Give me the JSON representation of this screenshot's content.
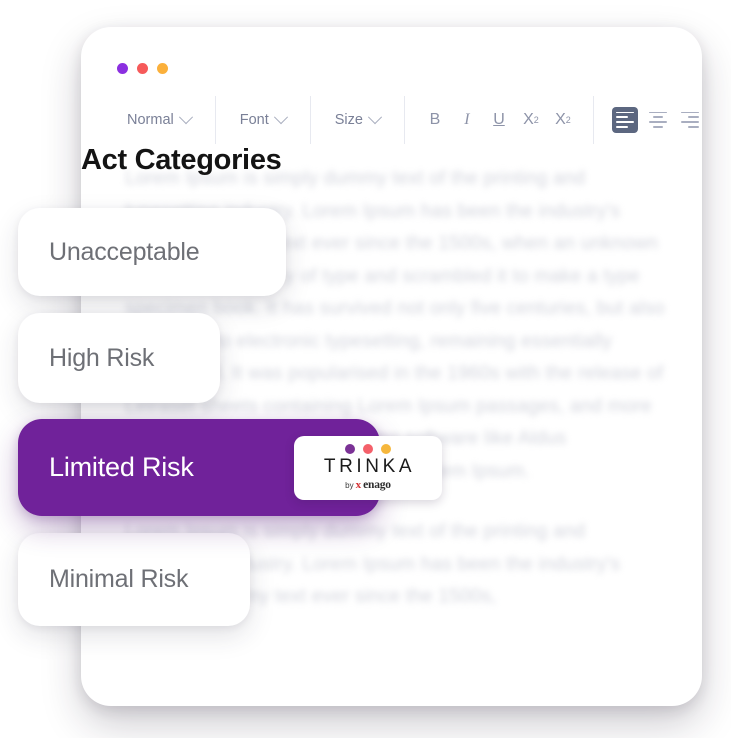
{
  "window": {
    "dots": [
      {
        "name": "purple",
        "color": "#8B2FE0"
      },
      {
        "name": "red",
        "color": "#F65A5A"
      },
      {
        "name": "amber",
        "color": "#FBB03B"
      }
    ]
  },
  "toolbar": {
    "style_select": "Normal",
    "font_select": "Font",
    "size_select": "Size",
    "format_buttons": [
      {
        "icon": "bold-icon",
        "label": "B"
      },
      {
        "icon": "italic-icon",
        "label": "I"
      },
      {
        "icon": "underline-icon",
        "label": "U"
      },
      {
        "icon": "subscript-icon",
        "label": "X",
        "script": "2"
      },
      {
        "icon": "superscript-icon",
        "label": "X",
        "script": "2"
      }
    ],
    "align_buttons": [
      {
        "icon": "align-left-icon",
        "active": true
      },
      {
        "icon": "align-center-icon",
        "active": false
      },
      {
        "icon": "align-right-icon",
        "active": false
      },
      {
        "icon": "align-justify-icon",
        "active": false
      }
    ],
    "list_buttons": [
      {
        "icon": "bulleted-list-icon"
      },
      {
        "icon": "checklist-icon"
      }
    ]
  },
  "page_title": "Act Categories",
  "document": {
    "paragraphs": [
      "Lorem Ipsum is simply dummy text of the printing and typesetting industry. Lorem Ipsum has been the industry's standard dummy text ever since the 1500s, when an unknown printer took a galley of type and scrambled it to make a type specimen book. It has survived not only five centuries, but also the leap into electronic typesetting, remaining essentially unchanged. It was popularised in the 1960s with the release of Letraset sheets containing Lorem Ipsum passages, and more recently with desktop publishing software like Aldus PageMaker including versions of Lorem Ipsum.",
      "Lorem Ipsum is simply dummy text of the printing and typesetting industry. Lorem Ipsum has been the industry's standard dummy text ever since the 1500s,"
    ]
  },
  "categories": [
    {
      "label": "Unacceptable",
      "selected": false
    },
    {
      "label": "High Risk",
      "selected": false
    },
    {
      "label": "Limited Risk",
      "selected": true,
      "accent": "#70229A"
    },
    {
      "label": "Minimal Risk",
      "selected": false
    }
  ],
  "brand": {
    "name": "TRINKA",
    "by": "by",
    "parent": "enago",
    "dots": [
      {
        "name": "purple",
        "color": "#7B3296"
      },
      {
        "name": "red",
        "color": "#F4606A"
      },
      {
        "name": "amber",
        "color": "#F6B73C"
      }
    ]
  }
}
